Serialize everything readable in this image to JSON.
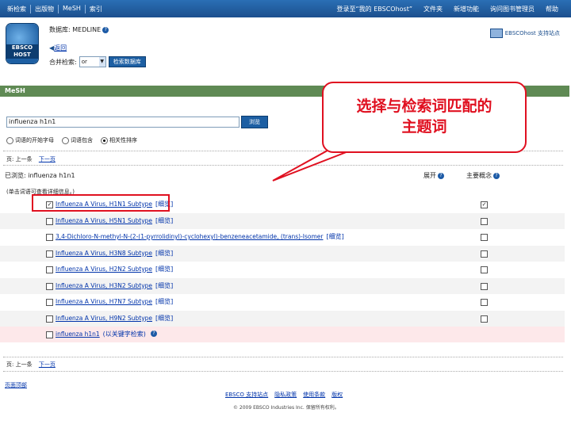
{
  "topnav": {
    "left": [
      "新检索",
      "出版物",
      "MeSH",
      "索引"
    ],
    "right": [
      "登录至“我的 EBSCOhost”",
      "文件夹",
      "新增功能",
      "询问图书管理员",
      "帮助"
    ]
  },
  "logo": {
    "text": "EBSCO HOST"
  },
  "database": {
    "label": "数据库: MEDLINE"
  },
  "back": {
    "label": "返回"
  },
  "combine": {
    "label": "合并检索:",
    "selected": "or",
    "button": "检索数据库"
  },
  "ebsco_support": {
    "text": "EBSCOhost 支持站点"
  },
  "section": {
    "title": "MeSH"
  },
  "search": {
    "value": "influenza h1n1",
    "button": "浏览"
  },
  "radios": [
    {
      "label": "词语的开始字母",
      "checked": false
    },
    {
      "label": "词语包含",
      "checked": false
    },
    {
      "label": "相关性排序",
      "checked": true
    }
  ],
  "pager_top": {
    "page": "页: 上一条",
    "next": "下一页"
  },
  "browsed": {
    "text": "已浏览: influenza h1n1"
  },
  "columns": {
    "expand": "展开",
    "major": "主要概念"
  },
  "hint": {
    "text": "(单击词语可查看详细信息。)"
  },
  "rows": [
    {
      "term": "Influenza A Virus, H1N1 Subtype",
      "note": "[细览]",
      "checked": true,
      "major": true
    },
    {
      "term": "Influenza A Virus, H5N1 Subtype",
      "note": "[细览]",
      "checked": false,
      "major": false
    },
    {
      "term": "3,4-Dichloro-N-methyl-N-(2-(1-pyrrolidinyl)-cyclohexyl)-benzeneacetamide, (trans)-Isomer",
      "note": "[细览]",
      "checked": false,
      "major": false
    },
    {
      "term": "Influenza A Virus, H3N8 Subtype",
      "note": "[细览]",
      "checked": false,
      "major": false
    },
    {
      "term": "Influenza A Virus, H2N2 Subtype",
      "note": "[细览]",
      "checked": false,
      "major": false
    },
    {
      "term": "Influenza A Virus, H3N2 Subtype",
      "note": "[细览]",
      "checked": false,
      "major": false
    },
    {
      "term": "Influenza A Virus, H7N7 Subtype",
      "note": "[细览]",
      "checked": false,
      "major": false
    },
    {
      "term": "Influenza A Virus, H9N2 Subtype",
      "note": "[细览]",
      "checked": false,
      "major": false
    },
    {
      "term": "influenza h1n1",
      "note": "(以关键字检索)",
      "checked": false,
      "major": null
    }
  ],
  "pager_bottom": {
    "page": "页: 上一条",
    "next": "下一页"
  },
  "results_foot": {
    "text": "页面顶部"
  },
  "footer": {
    "links": [
      "EBSCO 支持站点",
      "隐私政策",
      "使用条款",
      "版权"
    ]
  },
  "copyright": {
    "text": "© 2009 EBSCO Industries Inc. 保留所有权利。"
  },
  "annotation": {
    "line1": "选择与检索词匹配的",
    "line2": "主题词"
  },
  "colors": {
    "topbar": "#1c4f8d",
    "section": "#5f8a54",
    "highlight": "#e01020",
    "link": "#0033aa"
  }
}
